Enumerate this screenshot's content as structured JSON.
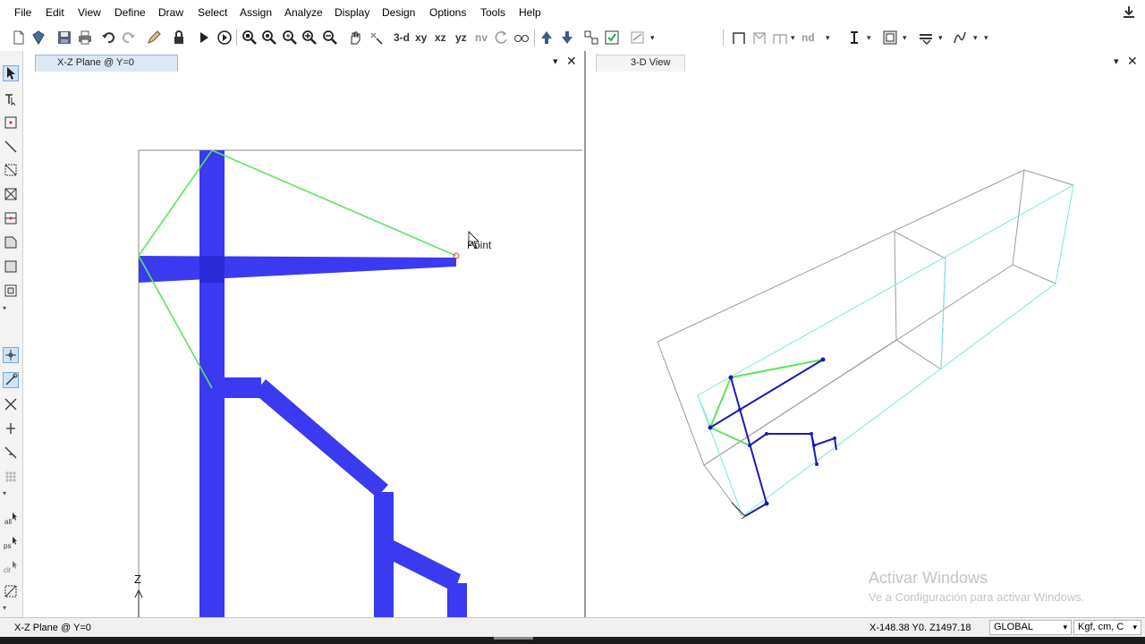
{
  "menu": {
    "items": [
      "File",
      "Edit",
      "View",
      "Define",
      "Draw",
      "Select",
      "Assign",
      "Analyze",
      "Display",
      "Design",
      "Options",
      "Tools",
      "Help"
    ]
  },
  "toolbar": {
    "view_3d_label": "3-d",
    "view_xy_label": "xy",
    "view_xz_label": "xz",
    "view_yz_label": "yz",
    "view_nv_label": "nv",
    "nd_label": "nd",
    "icons": [
      "new-model-icon",
      "open-icon",
      "save-icon",
      "print-icon",
      "undo-icon",
      "redo-icon",
      "lock-icon",
      "run-analysis-icon",
      "run-step-icon",
      "zoom-window-icon",
      "zoom-restore-icon",
      "zoom-in-icon",
      "zoom-out-icon",
      "pan-icon",
      "rubber-band-icon"
    ]
  },
  "left_panel": {
    "title": "X-Z Plane @ Y=0",
    "tooltip": "Point",
    "axis_label": "Z"
  },
  "right_panel": {
    "title": "3-D View"
  },
  "status": {
    "view_label": "X-Z Plane @ Y=0",
    "coordinates": "X-148.38  Y0.  Z1497.18",
    "coord_system": "GLOBAL",
    "units": "Kgf, cm, C"
  },
  "watermark": {
    "title": "Activar Windows",
    "subtitle": "Ve a Configuración para activar Windows."
  },
  "colors": {
    "frame_blue": "#3a3af0",
    "frame_blue_dark": "#1a1ab8",
    "brace_green": "#5ae65a",
    "outline_gray": "#999999",
    "outline_cyan": "#7fe3e3"
  }
}
